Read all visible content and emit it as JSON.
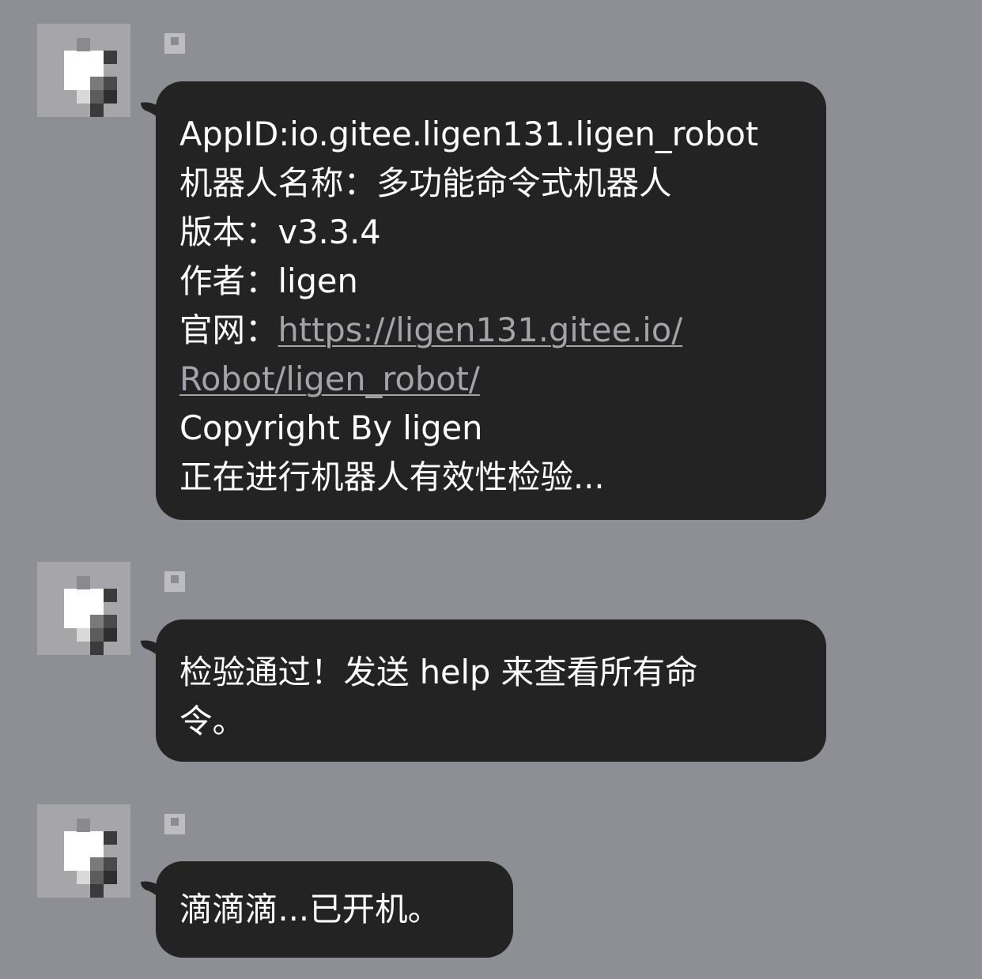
{
  "messages": [
    {
      "lines": {
        "appid": "AppID:io.gitee.ligen131.ligen_robot",
        "robot_name_label": "机器人名称：",
        "robot_name_value": "多功能命令式机器人",
        "version_label": "版本：",
        "version_value": "v3.3.4",
        "author_label": "作者：",
        "author_value": "ligen",
        "website_label": "官网：",
        "website_url_part1": "https://ligen131.gitee.io/",
        "website_url_part2": "Robot/ligen_robot/",
        "copyright": "Copyright By ligen",
        "checking": "正在进行机器人有效性检验..."
      }
    },
    {
      "lines": {
        "line1": "检验通过！发送 help 来查看所有命",
        "line2": "令。"
      }
    },
    {
      "lines": {
        "line1": "滴滴滴...已开机。"
      }
    }
  ],
  "colors": {
    "background": "#8e8f94",
    "bubble": "#232324",
    "text": "#ffffff",
    "link": "#a3a3a8"
  },
  "icons": {
    "avatar": "pixelated-avatar",
    "name_tag": "sender-badge"
  }
}
